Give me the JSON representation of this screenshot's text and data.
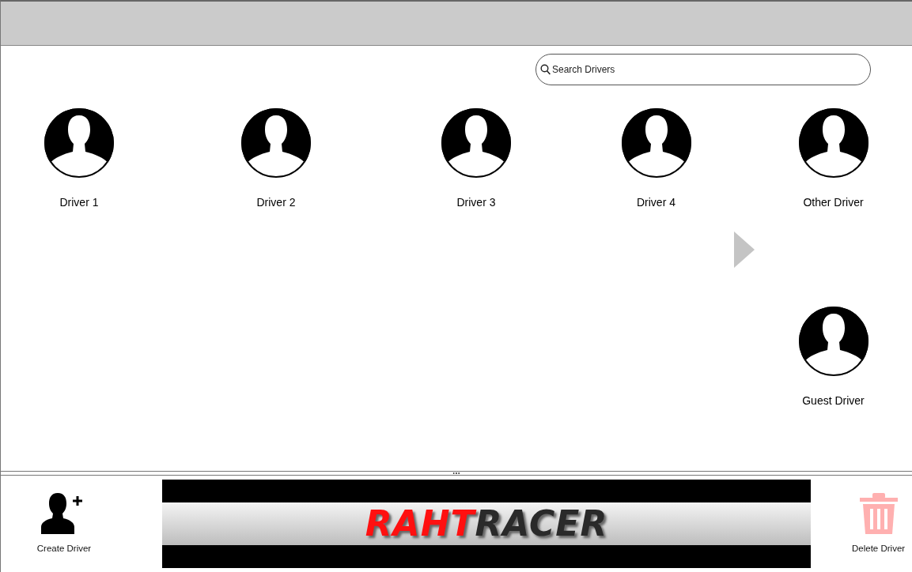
{
  "search": {
    "placeholder": "Search Drivers"
  },
  "drivers": [
    {
      "name": "Driver 1"
    },
    {
      "name": "Driver 2"
    },
    {
      "name": "Driver 3"
    },
    {
      "name": "Driver 4"
    },
    {
      "name": "Other Driver"
    }
  ],
  "guest_driver": {
    "name": "Guest Driver"
  },
  "footer": {
    "create_button": {
      "label": "Create Driver",
      "disabled": false
    },
    "logo": {
      "part_1": "RAHT",
      "part_2": "RACER"
    },
    "delete_button": {
      "label": "Delete Driver",
      "disabled": true
    }
  }
}
